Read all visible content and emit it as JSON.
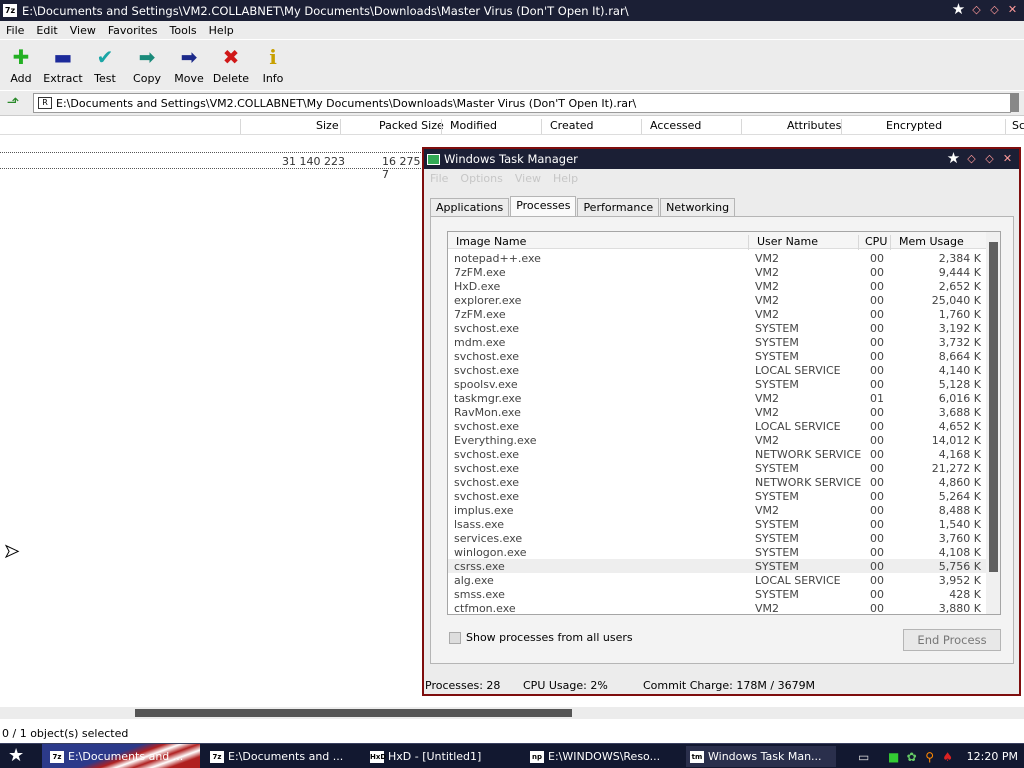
{
  "zip": {
    "title": "E:\\Documents and Settings\\VM2.COLLABNET\\My Documents\\Downloads\\Master Virus (Don'T Open It).rar\\",
    "app_icon": "7z",
    "menu": [
      "File",
      "Edit",
      "View",
      "Favorites",
      "Tools",
      "Help"
    ],
    "toolbar": [
      {
        "label": "Add",
        "icon": "plus-icon",
        "glyph": "✚",
        "color": "#23b023"
      },
      {
        "label": "Extract",
        "icon": "minus-icon",
        "glyph": "▬",
        "color": "#1c2a9a"
      },
      {
        "label": "Test",
        "icon": "check-icon",
        "glyph": "✔",
        "color": "#1aa6a6"
      },
      {
        "label": "Copy",
        "icon": "arrow-right-icon",
        "glyph": "➡",
        "color": "#1a8a7a"
      },
      {
        "label": "Move",
        "icon": "arrow-right-icon",
        "glyph": "➡",
        "color": "#1c2a8a"
      },
      {
        "label": "Delete",
        "icon": "x-icon",
        "glyph": "✖",
        "color": "#d01818"
      },
      {
        "label": "Info",
        "icon": "info-icon",
        "glyph": "i",
        "color": "#c8a000"
      }
    ],
    "address": "E:\\Documents and Settings\\VM2.COLLABNET\\My Documents\\Downloads\\Master Virus (Don'T Open It).rar\\",
    "columns": [
      "Size",
      "Packed Size",
      "Modified",
      "Created",
      "Accessed",
      "Attributes",
      "Encrypted",
      "Sc"
    ],
    "row": {
      "size": "31 140 223",
      "packed": "16 275 7"
    },
    "status": "0 / 1 object(s) selected"
  },
  "taskmgr": {
    "title": "Windows Task Manager",
    "menu": [
      "File",
      "Options",
      "View",
      "Help"
    ],
    "tabs": [
      "Applications",
      "Processes",
      "Performance",
      "Networking"
    ],
    "active_tab": "Processes",
    "columns": [
      "Image Name",
      "User Name",
      "CPU",
      "Mem Usage"
    ],
    "processes": [
      [
        "notepad++.exe",
        "VM2",
        "00",
        "2,384 K"
      ],
      [
        "7zFM.exe",
        "VM2",
        "00",
        "9,444 K"
      ],
      [
        "HxD.exe",
        "VM2",
        "00",
        "2,652 K"
      ],
      [
        "explorer.exe",
        "VM2",
        "00",
        "25,040 K"
      ],
      [
        "7zFM.exe",
        "VM2",
        "00",
        "1,760 K"
      ],
      [
        "svchost.exe",
        "SYSTEM",
        "00",
        "3,192 K"
      ],
      [
        "mdm.exe",
        "SYSTEM",
        "00",
        "3,732 K"
      ],
      [
        "svchost.exe",
        "SYSTEM",
        "00",
        "8,664 K"
      ],
      [
        "svchost.exe",
        "LOCAL SERVICE",
        "00",
        "4,140 K"
      ],
      [
        "spoolsv.exe",
        "SYSTEM",
        "00",
        "5,128 K"
      ],
      [
        "taskmgr.exe",
        "VM2",
        "01",
        "6,016 K"
      ],
      [
        "RavMon.exe",
        "VM2",
        "00",
        "3,688 K"
      ],
      [
        "svchost.exe",
        "LOCAL SERVICE",
        "00",
        "4,652 K"
      ],
      [
        "Everything.exe",
        "VM2",
        "00",
        "14,012 K"
      ],
      [
        "svchost.exe",
        "NETWORK SERVICE",
        "00",
        "4,168 K"
      ],
      [
        "svchost.exe",
        "SYSTEM",
        "00",
        "21,272 K"
      ],
      [
        "svchost.exe",
        "NETWORK SERVICE",
        "00",
        "4,860 K"
      ],
      [
        "svchost.exe",
        "SYSTEM",
        "00",
        "5,264 K"
      ],
      [
        "implus.exe",
        "VM2",
        "00",
        "8,488 K"
      ],
      [
        "lsass.exe",
        "SYSTEM",
        "00",
        "1,540 K"
      ],
      [
        "services.exe",
        "SYSTEM",
        "00",
        "3,760 K"
      ],
      [
        "winlogon.exe",
        "SYSTEM",
        "00",
        "4,108 K"
      ],
      [
        "csrss.exe",
        "SYSTEM",
        "00",
        "5,756 K"
      ],
      [
        "alg.exe",
        "LOCAL SERVICE",
        "00",
        "3,952 K"
      ],
      [
        "smss.exe",
        "SYSTEM",
        "00",
        "428 K"
      ],
      [
        "ctfmon.exe",
        "VM2",
        "00",
        "3,880 K"
      ]
    ],
    "selected_process": "csrss.exe",
    "show_all_label": "Show processes from all users",
    "end_process_label": "End Process",
    "status": {
      "processes": "Processes: 28",
      "cpu": "CPU Usage: 2%",
      "commit": "Commit Charge: 178M / 3679M"
    }
  },
  "taskbar": {
    "tasks": [
      {
        "label": "E:\\Documents and ...",
        "icon": "7z"
      },
      {
        "label": "E:\\Documents and ...",
        "icon": "7z"
      },
      {
        "label": "HxD - [Untitled1]",
        "icon": "HxD"
      },
      {
        "label": "E:\\WINDOWS\\Reso...",
        "icon": "np"
      },
      {
        "label": "Windows Task Man...",
        "icon": "tm"
      }
    ],
    "clock": "12:20 PM"
  }
}
